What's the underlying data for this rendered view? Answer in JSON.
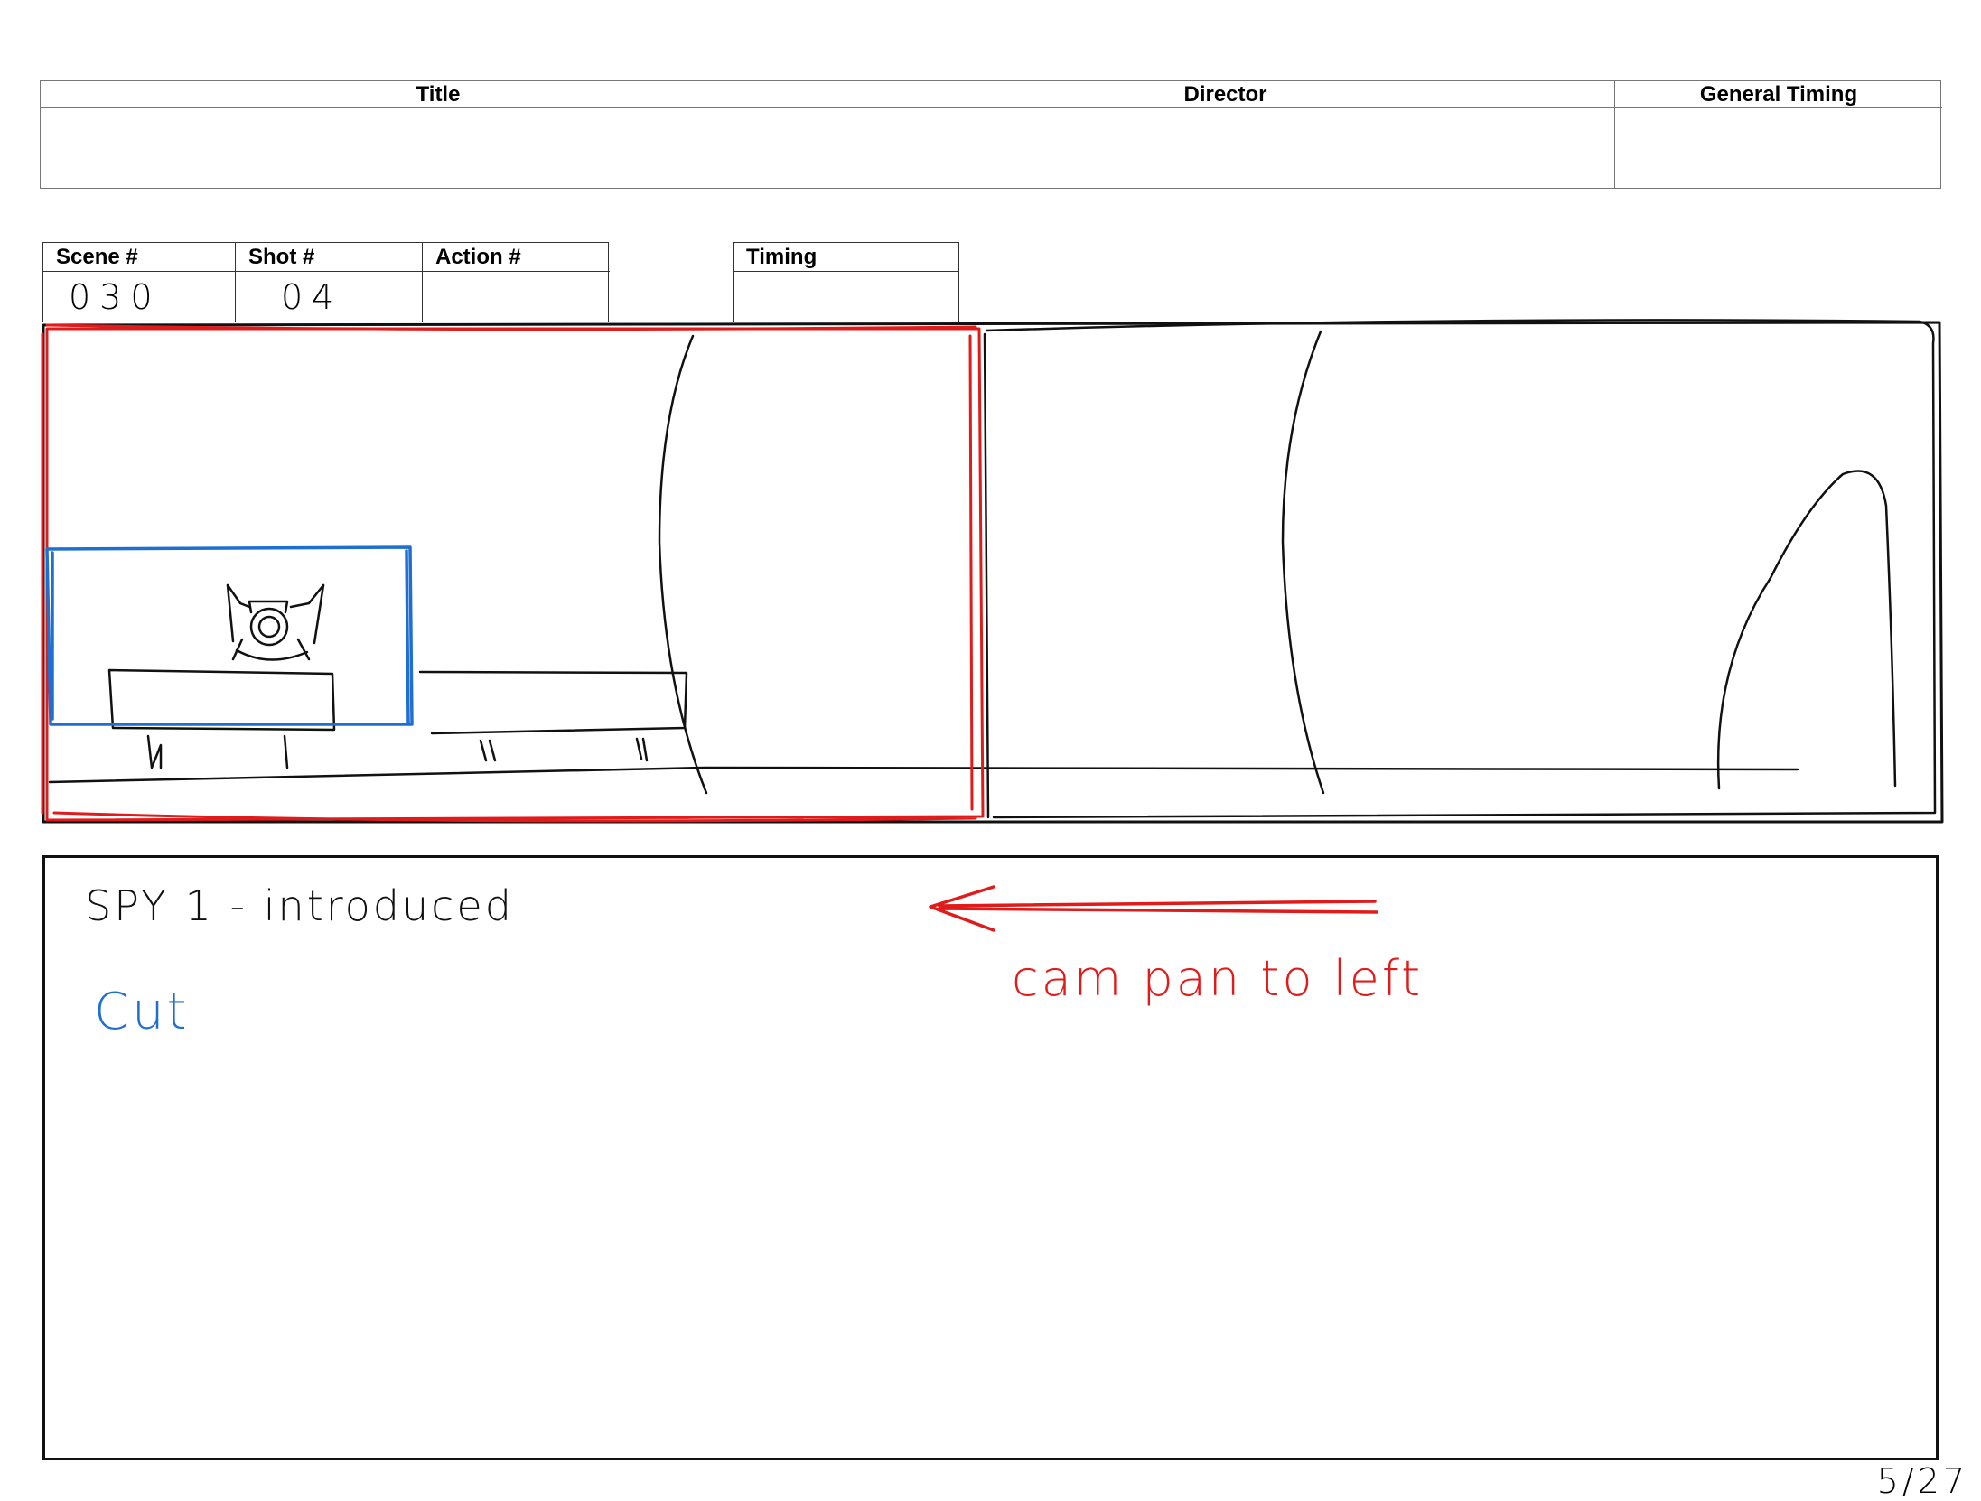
{
  "header": {
    "title_label": "Title",
    "director_label": "Director",
    "timing_label": "General Timing"
  },
  "shot_info": {
    "scene_label": "Scene #",
    "scene_value": "030",
    "shot_label": "Shot #",
    "shot_value": "04",
    "action_label": "Action #",
    "timing_label": "Timing"
  },
  "notes": {
    "line1": "SPY 1 - introduced",
    "line2": "Cut",
    "pan_note": "cam pan to left"
  },
  "page_number": "5/27",
  "colors": {
    "pan_frame": "#e01b1b",
    "cut_frame": "#1f6fd0",
    "sketch": "#111111"
  }
}
